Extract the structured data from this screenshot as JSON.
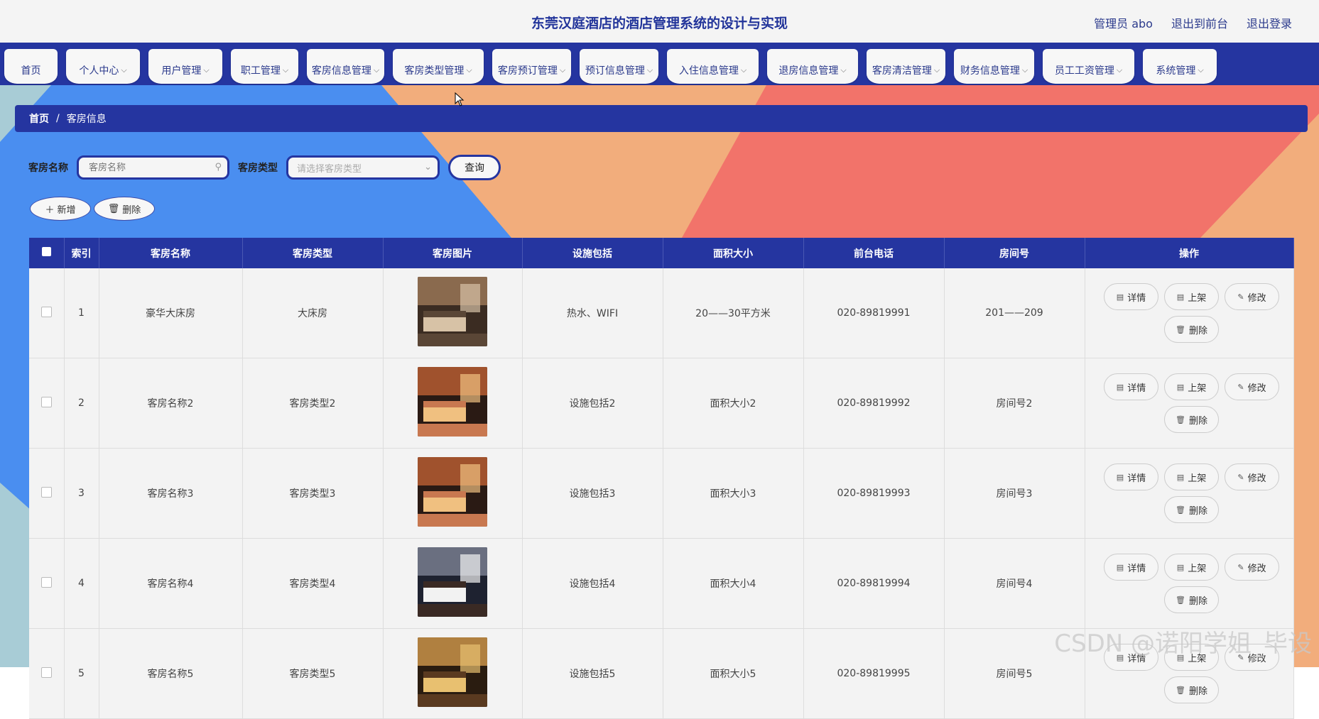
{
  "app": {
    "title": "东莞汉庭酒店的酒店管理系统的设计与实现"
  },
  "top_links": [
    "管理员 abo",
    "退出到前台",
    "退出登录"
  ],
  "nav": [
    {
      "label": "首页",
      "dropdown": false
    },
    {
      "label": "个人中心",
      "dropdown": true
    },
    {
      "label": "用户管理",
      "dropdown": true
    },
    {
      "label": "职工管理",
      "dropdown": true
    },
    {
      "label": "客房信息管理",
      "dropdown": true
    },
    {
      "label": "客房类型管理",
      "dropdown": true
    },
    {
      "label": "客房预订管理",
      "dropdown": true
    },
    {
      "label": "预订信息管理",
      "dropdown": true
    },
    {
      "label": "入住信息管理",
      "dropdown": true
    },
    {
      "label": "退房信息管理",
      "dropdown": true
    },
    {
      "label": "客房清洁管理",
      "dropdown": true
    },
    {
      "label": "财务信息管理",
      "dropdown": true
    },
    {
      "label": "员工工资管理",
      "dropdown": true
    },
    {
      "label": "系统管理",
      "dropdown": true
    }
  ],
  "breadcrumb": {
    "home": "首页",
    "separator": "/",
    "current": "客房信息"
  },
  "search": {
    "name_label": "客房名称",
    "name_placeholder": "客房名称",
    "type_label": "客房类型",
    "type_placeholder": "请选择客房类型",
    "query_label": "查询"
  },
  "actions": {
    "add_label": "新增",
    "delete_label": "删除"
  },
  "table": {
    "columns": [
      "索引",
      "客房名称",
      "客房类型",
      "客房图片",
      "设施包括",
      "面积大小",
      "前台电话",
      "房间号",
      "操作"
    ],
    "op_labels": {
      "detail": "详情",
      "publish": "上架",
      "edit": "修改",
      "delete": "删除"
    },
    "rows": [
      {
        "index": "1",
        "name": "豪华大床房",
        "type": "大床房",
        "image": "room-photo-1",
        "facilities": "热水、WIFI",
        "area": "20——30平方米",
        "phone": "020-89819991",
        "room_no": "201——209"
      },
      {
        "index": "2",
        "name": "客房名称2",
        "type": "客房类型2",
        "image": "room-photo-2",
        "facilities": "设施包括2",
        "area": "面积大小2",
        "phone": "020-89819992",
        "room_no": "房间号2"
      },
      {
        "index": "3",
        "name": "客房名称3",
        "type": "客房类型3",
        "image": "room-photo-3",
        "facilities": "设施包括3",
        "area": "面积大小3",
        "phone": "020-89819993",
        "room_no": "房间号3"
      },
      {
        "index": "4",
        "name": "客房名称4",
        "type": "客房类型4",
        "image": "room-photo-4",
        "facilities": "设施包括4",
        "area": "面积大小4",
        "phone": "020-89819994",
        "room_no": "房间号4"
      },
      {
        "index": "5",
        "name": "客房名称5",
        "type": "客房类型5",
        "image": "room-photo-5",
        "facilities": "设施包括5",
        "area": "面积大小5",
        "phone": "020-89819995",
        "room_no": "房间号5"
      }
    ]
  },
  "watermark": "CSDN @诺阳学姐_毕设",
  "colors": {
    "primary": "#2535a0",
    "bg_blue": "#4a8ef0",
    "bg_orange": "#f2ad7c",
    "bg_red": "#f2736a",
    "bg_teal": "#a8ccd6"
  }
}
